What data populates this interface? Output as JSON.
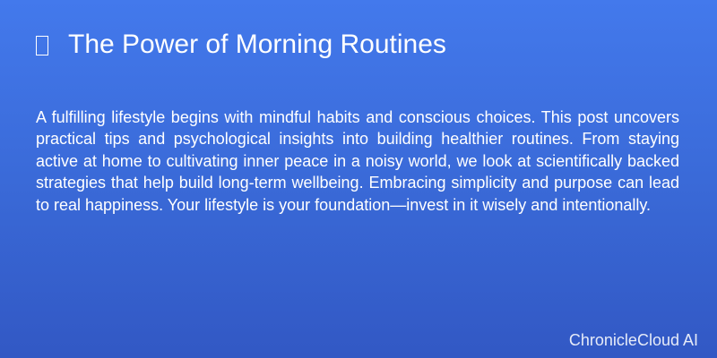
{
  "post": {
    "title_icon": "missing-glyph-icon",
    "title": "The Power of Morning Routines",
    "body": "A fulfilling lifestyle begins with mindful habits and conscious choices. This post uncovers practical tips and psychological insights into building healthier routines. From staying active at home to cultivating inner peace in a noisy world, we look at scientifically backed strategies that help build long-term wellbeing. Embracing simplicity and purpose can lead to real happiness. Your lifestyle is your foundation—invest in it wisely and intentionally."
  },
  "footer": {
    "brand": "ChronicleCloud AI"
  },
  "colors": {
    "background_top": "#4379ec",
    "background_bottom": "#3258c4",
    "text": "#ffffff"
  }
}
